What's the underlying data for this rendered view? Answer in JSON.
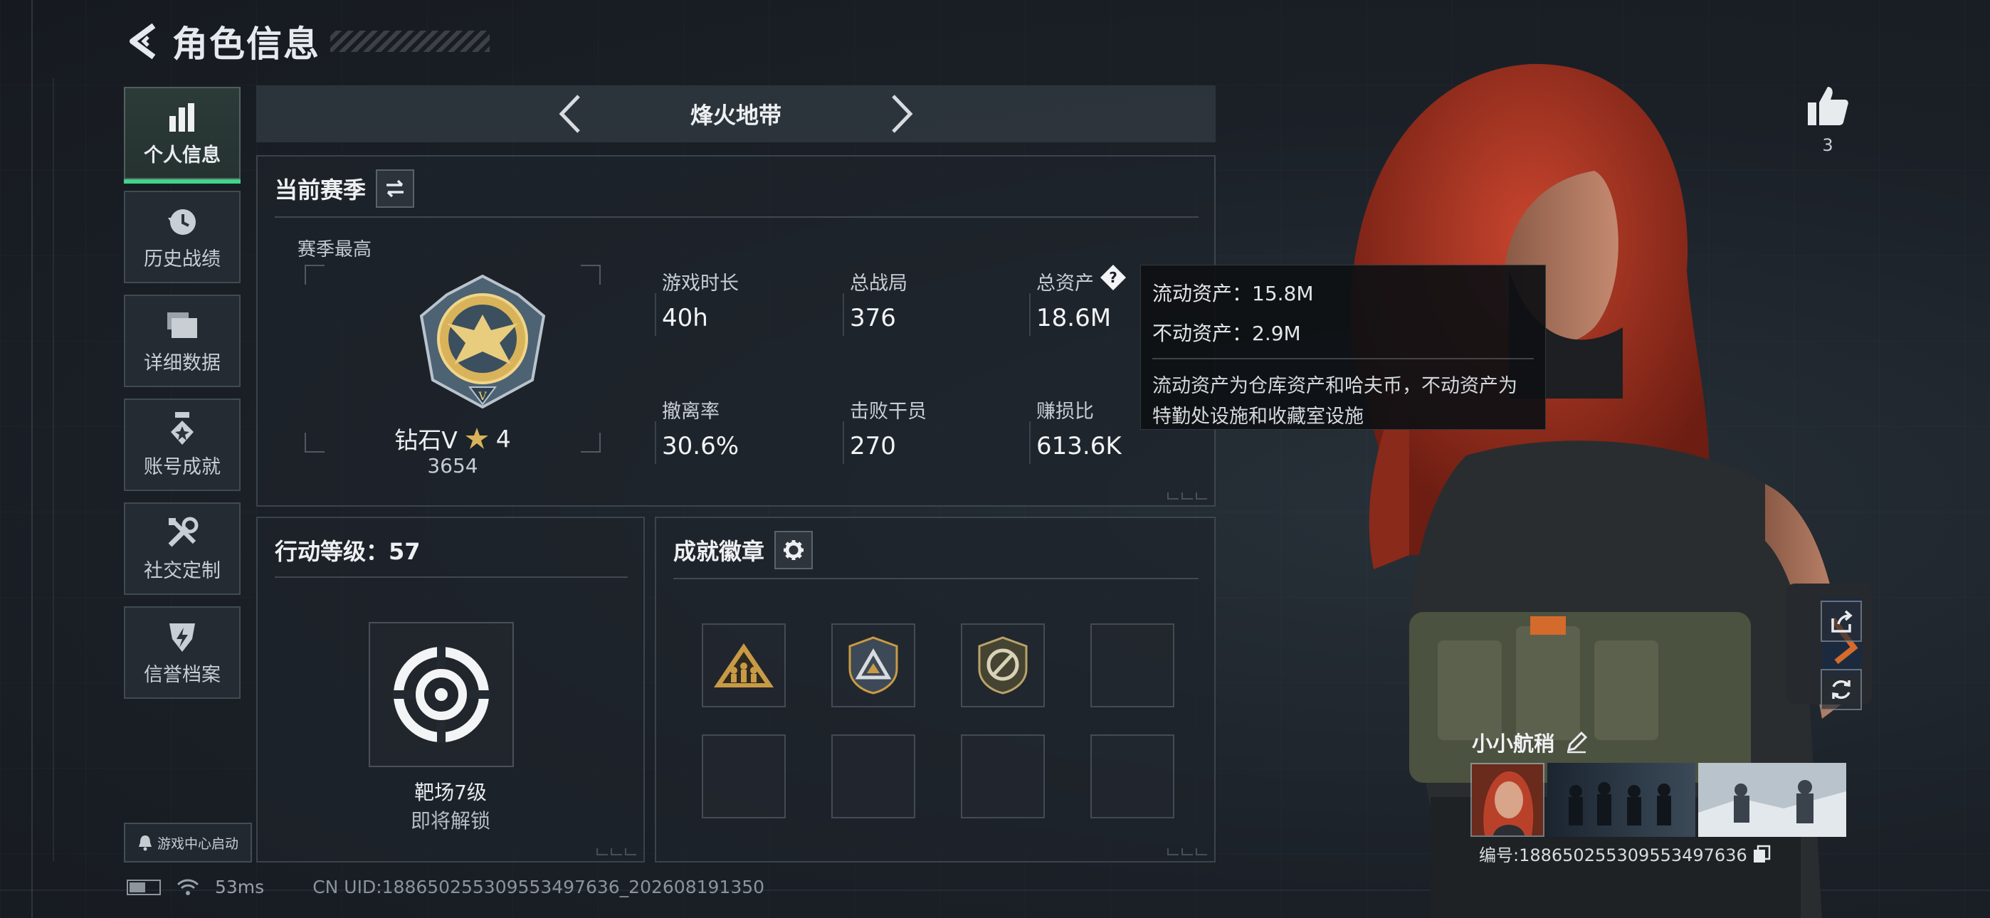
{
  "header": {
    "title": "角色信息"
  },
  "sidebar": {
    "items": [
      {
        "label": "个人信息",
        "icon": "bar-chart-icon",
        "active": true
      },
      {
        "label": "历史战绩",
        "icon": "history-icon",
        "active": false
      },
      {
        "label": "详细数据",
        "icon": "folder-icon",
        "active": false
      },
      {
        "label": "账号成就",
        "icon": "medal-icon",
        "active": false
      },
      {
        "label": "社交定制",
        "icon": "tools-icon",
        "active": false
      },
      {
        "label": "信誉档案",
        "icon": "shield-bolt-icon",
        "active": false
      }
    ],
    "launch_button": "游戏中心启动"
  },
  "mode_selector": {
    "title": "烽火地带"
  },
  "season_panel": {
    "title": "当前赛季",
    "subtitle": "赛季最高",
    "rank_name": "钻石V",
    "rank_stars": "4",
    "rank_score": "3654",
    "stats": [
      {
        "label": "游戏时长",
        "value": "40h"
      },
      {
        "label": "总战局",
        "value": "376"
      },
      {
        "label": "总资产",
        "value": "18.6M"
      },
      {
        "label": "撤离率",
        "value": "30.6%"
      },
      {
        "label": "击败干员",
        "value": "270"
      },
      {
        "label": "赚损比",
        "value": "613.6K"
      }
    ]
  },
  "tooltip": {
    "line1": "流动资产：15.8M",
    "line2": "不动资产：2.9M",
    "desc": "流动资产为仓库资产和哈夫币，不动资产为特勤处设施和收藏室设施"
  },
  "level_panel": {
    "title": "行动等级：57",
    "item_name": "靶场7级",
    "item_status": "即将解锁"
  },
  "badge_panel": {
    "title": "成就徽章"
  },
  "status_bar": {
    "ping": "53ms",
    "uid": "CN UID:18865025530955349763​6_202608191350"
  },
  "right_panel": {
    "like_count": "3",
    "player_name": "小小航稍",
    "player_id": "编号:18865025530955349763​6"
  },
  "colors": {
    "accent_green": "#3fd58a",
    "tooltip_bg": "#0e1013",
    "gold": "#d9b35a"
  }
}
